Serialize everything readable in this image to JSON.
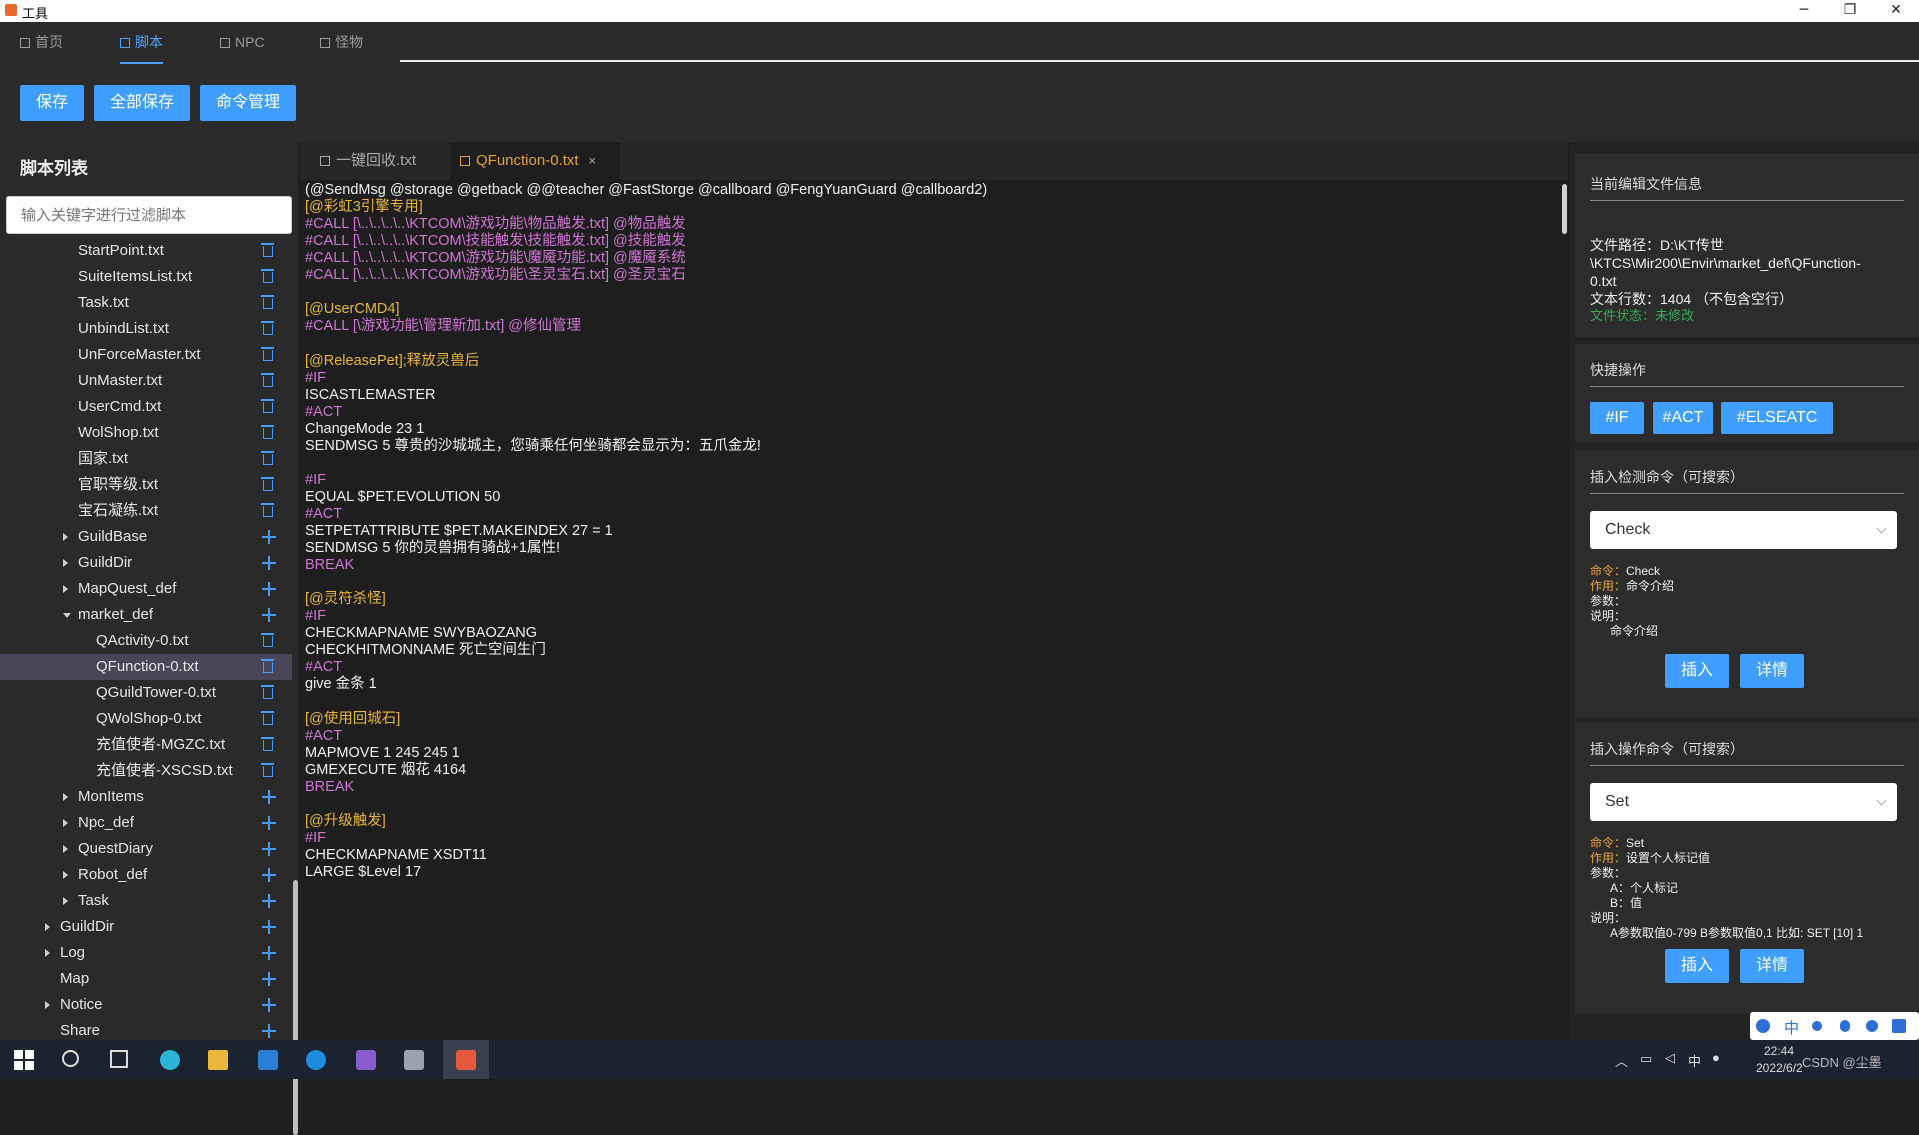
{
  "window": {
    "title": "工具",
    "minimize": "─",
    "restore": "❐",
    "close": "✕"
  },
  "nav": {
    "tabs": [
      "首页",
      "脚本",
      "NPC",
      "怪物"
    ],
    "active": 1
  },
  "toolbar": {
    "save": "保存",
    "save_all": "全部保存",
    "cmd_manage": "命令管理"
  },
  "sidebar": {
    "title": "脚本列表",
    "filter_placeholder": "输入关键字进行过滤脚本",
    "items": [
      {
        "label": "StartPoint.txt",
        "depth": 2,
        "type": "file"
      },
      {
        "label": "SuiteItemsList.txt",
        "depth": 2,
        "type": "file"
      },
      {
        "label": "Task.txt",
        "depth": 2,
        "type": "file"
      },
      {
        "label": "UnbindList.txt",
        "depth": 2,
        "type": "file"
      },
      {
        "label": "UnForceMaster.txt",
        "depth": 2,
        "type": "file"
      },
      {
        "label": "UnMaster.txt",
        "depth": 2,
        "type": "file"
      },
      {
        "label": "UserCmd.txt",
        "depth": 2,
        "type": "file"
      },
      {
        "label": "WolShop.txt",
        "depth": 2,
        "type": "file"
      },
      {
        "label": "国家.txt",
        "depth": 2,
        "type": "file"
      },
      {
        "label": "官职等级.txt",
        "depth": 2,
        "type": "file"
      },
      {
        "label": "宝石凝练.txt",
        "depth": 2,
        "type": "file"
      },
      {
        "label": "GuildBase",
        "depth": 2,
        "type": "folder"
      },
      {
        "label": "GuildDir",
        "depth": 2,
        "type": "folder"
      },
      {
        "label": "MapQuest_def",
        "depth": 2,
        "type": "folder"
      },
      {
        "label": "market_def",
        "depth": 2,
        "type": "folder-open"
      },
      {
        "label": "QActivity-0.txt",
        "depth": 3,
        "type": "file"
      },
      {
        "label": "QFunction-0.txt",
        "depth": 3,
        "type": "file",
        "selected": true
      },
      {
        "label": "QGuildTower-0.txt",
        "depth": 3,
        "type": "file"
      },
      {
        "label": "QWolShop-0.txt",
        "depth": 3,
        "type": "file"
      },
      {
        "label": "充值使者-MGZC.txt",
        "depth": 3,
        "type": "file"
      },
      {
        "label": "充值使者-XSCSD.txt",
        "depth": 3,
        "type": "file"
      },
      {
        "label": "MonItems",
        "depth": 2,
        "type": "folder"
      },
      {
        "label": "Npc_def",
        "depth": 2,
        "type": "folder"
      },
      {
        "label": "QuestDiary",
        "depth": 2,
        "type": "folder"
      },
      {
        "label": "Robot_def",
        "depth": 2,
        "type": "folder"
      },
      {
        "label": "Task",
        "depth": 2,
        "type": "folder"
      },
      {
        "label": "GuildDir",
        "depth": 1,
        "type": "folder"
      },
      {
        "label": "Log",
        "depth": 1,
        "type": "folder"
      },
      {
        "label": "Map",
        "depth": 1,
        "type": "leaf-folder"
      },
      {
        "label": "Notice",
        "depth": 1,
        "type": "folder"
      },
      {
        "label": "Share",
        "depth": 1,
        "type": "leaf-folder"
      }
    ]
  },
  "editor": {
    "tabs": [
      {
        "label": "一键回收.txt",
        "active": false
      },
      {
        "label": "QFunction-0.txt",
        "active": true,
        "close": "×"
      }
    ],
    "lines": [
      {
        "t": "(@SendMsg @storage @getback @@teacher @FastStorge @callboard @FengYuanGuard @callboard2)",
        "c": "w"
      },
      {
        "t": "[@彩虹3引擎专用]",
        "c": "o"
      },
      {
        "t": "#CALL [\\..\\..\\..\\..\\KTCOM\\游戏功能\\物品触发.txt] @物品触发",
        "c": "p"
      },
      {
        "t": "#CALL [\\..\\..\\..\\..\\KTCOM\\技能触发\\技能触发.txt] @技能触发",
        "c": "p"
      },
      {
        "t": "#CALL [\\..\\..\\..\\..\\KTCOM\\游戏功能\\魔魇功能.txt] @魔魇系统",
        "c": "p"
      },
      {
        "t": "#CALL [\\..\\..\\..\\..\\KTCOM\\游戏功能\\圣灵宝石.txt] @圣灵宝石",
        "c": "p"
      },
      {
        "t": "",
        "c": "w"
      },
      {
        "t": "[@UserCMD4]",
        "c": "o"
      },
      {
        "t": "#CALL [\\游戏功能\\管理新加.txt] @修仙管理",
        "c": "p"
      },
      {
        "t": "",
        "c": "w"
      },
      {
        "t": "[@ReleasePet];释放灵兽后",
        "c": "o"
      },
      {
        "t": "#IF",
        "c": "p"
      },
      {
        "t": "ISCASTLEMASTER",
        "c": "w"
      },
      {
        "t": "#ACT",
        "c": "p"
      },
      {
        "t": "ChangeMode 23 1",
        "c": "w"
      },
      {
        "t": "SENDMSG 5 尊贵的沙城城主，您骑乘任何坐骑都会显示为：五爪金龙!",
        "c": "w"
      },
      {
        "t": "",
        "c": "w"
      },
      {
        "t": "#IF",
        "c": "p"
      },
      {
        "t": "EQUAL $PET.EVOLUTION 50",
        "c": "w"
      },
      {
        "t": "#ACT",
        "c": "p"
      },
      {
        "t": "SETPETATTRIBUTE $PET.MAKEINDEX 27 = 1",
        "c": "w"
      },
      {
        "t": "SENDMSG 5 你的灵兽拥有骑战+1属性!",
        "c": "w"
      },
      {
        "t": "BREAK",
        "c": "p"
      },
      {
        "t": "",
        "c": "w"
      },
      {
        "t": "[@灵符杀怪]",
        "c": "o"
      },
      {
        "t": "#IF",
        "c": "p"
      },
      {
        "t": "CHECKMAPNAME SWYBAOZANG",
        "c": "w"
      },
      {
        "t": "CHECKHITMONNAME 死亡空间生门",
        "c": "w"
      },
      {
        "t": "#ACT",
        "c": "p"
      },
      {
        "t": "give 金条 1",
        "c": "w"
      },
      {
        "t": "",
        "c": "w"
      },
      {
        "t": "[@使用回城石]",
        "c": "o"
      },
      {
        "t": "#ACT",
        "c": "p"
      },
      {
        "t": "MAPMOVE 1 245 245 1",
        "c": "w"
      },
      {
        "t": "GMEXECUTE 烟花 4164",
        "c": "w"
      },
      {
        "t": "BREAK",
        "c": "p"
      },
      {
        "t": "",
        "c": "w"
      },
      {
        "t": "[@升级触发]",
        "c": "o"
      },
      {
        "t": "#IF",
        "c": "p"
      },
      {
        "t": "CHECKMAPNAME XSDT11",
        "c": "w"
      },
      {
        "t": "LARGE $Level 17",
        "c": "w"
      }
    ]
  },
  "fileinfo": {
    "title": "当前编辑文件信息",
    "path_line1": "文件路径：D:\\KT传世",
    "path_line2": "\\KTCS\\Mir200\\Envir\\market_def\\QFunction-",
    "path_line3": "0.txt",
    "lines": "文本行数：1404 （不包含空行）",
    "status": "文件状态：未修改"
  },
  "quick": {
    "title": "快捷操作",
    "buttons": [
      "#IF",
      "#ACT",
      "#ELSEATC"
    ]
  },
  "check_cmd": {
    "title": "插入检测命令（可搜索）",
    "selected": "Check",
    "cmd_label": "命令：",
    "cmd": "Check",
    "use_label": "作用：",
    "use": "命令介绍",
    "param_label": "参数：",
    "desc_label": "说明：",
    "desc": "命令介绍",
    "insert": "插入",
    "detail": "详情"
  },
  "act_cmd": {
    "title": "插入操作命令（可搜索）",
    "selected": "Set",
    "cmd_label": "命令：",
    "cmd": "Set",
    "use_label": "作用：",
    "use": "设置个人标记值",
    "param_label": "参数：",
    "param_a": "A：个人标记",
    "param_b": "B：值",
    "desc_label": "说明：",
    "desc": "A参数取值0-799 B参数取值0,1 比如: SET [10] 1",
    "insert": "插入",
    "detail": "详情"
  },
  "taskbar": {
    "time": "22:44",
    "date": "2022/6/2",
    "ime": "中",
    "watermark": "CSDN @尘墨"
  }
}
